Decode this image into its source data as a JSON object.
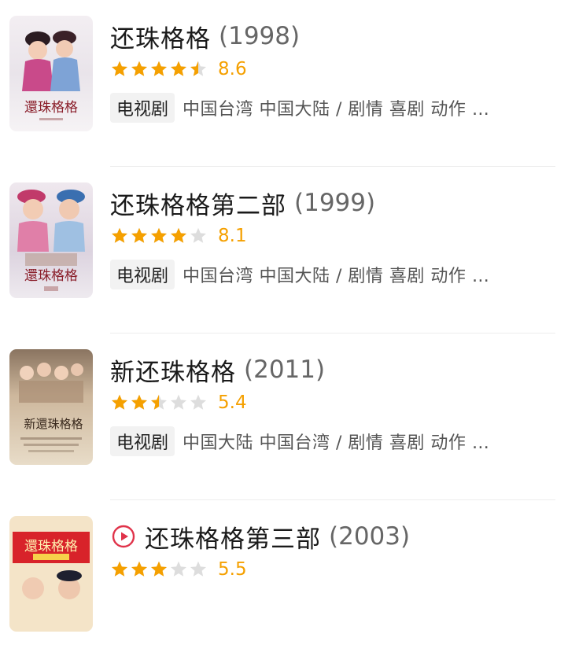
{
  "colors": {
    "star_on": "#f5a000",
    "star_off": "#dddddd",
    "play_icon": "#e0334a"
  },
  "items": [
    {
      "title": "还珠格格",
      "year": "(1998)",
      "stars": 4.5,
      "score": "8.6",
      "tag": "电视剧",
      "meta": "中国台湾 中国大陆 / 剧情 喜剧 动作 …",
      "poster_text": "還珠格格",
      "has_play": false
    },
    {
      "title": "还珠格格第二部",
      "year": "(1999)",
      "stars": 4,
      "score": "8.1",
      "tag": "电视剧",
      "meta": "中国台湾 中国大陆 / 剧情 喜剧 动作 …",
      "poster_text": "還珠格格",
      "has_play": false
    },
    {
      "title": "新还珠格格",
      "year": "(2011)",
      "stars": 2.5,
      "score": "5.4",
      "tag": "电视剧",
      "meta": "中国大陆 中国台湾 / 剧情 喜剧 动作 …",
      "poster_text": "新還珠格格",
      "has_play": false
    },
    {
      "title": "还珠格格第三部",
      "year": "(2003)",
      "stars": 3,
      "score": "5.5",
      "tag": "",
      "meta": "",
      "poster_text": "還珠格格",
      "has_play": true
    }
  ]
}
